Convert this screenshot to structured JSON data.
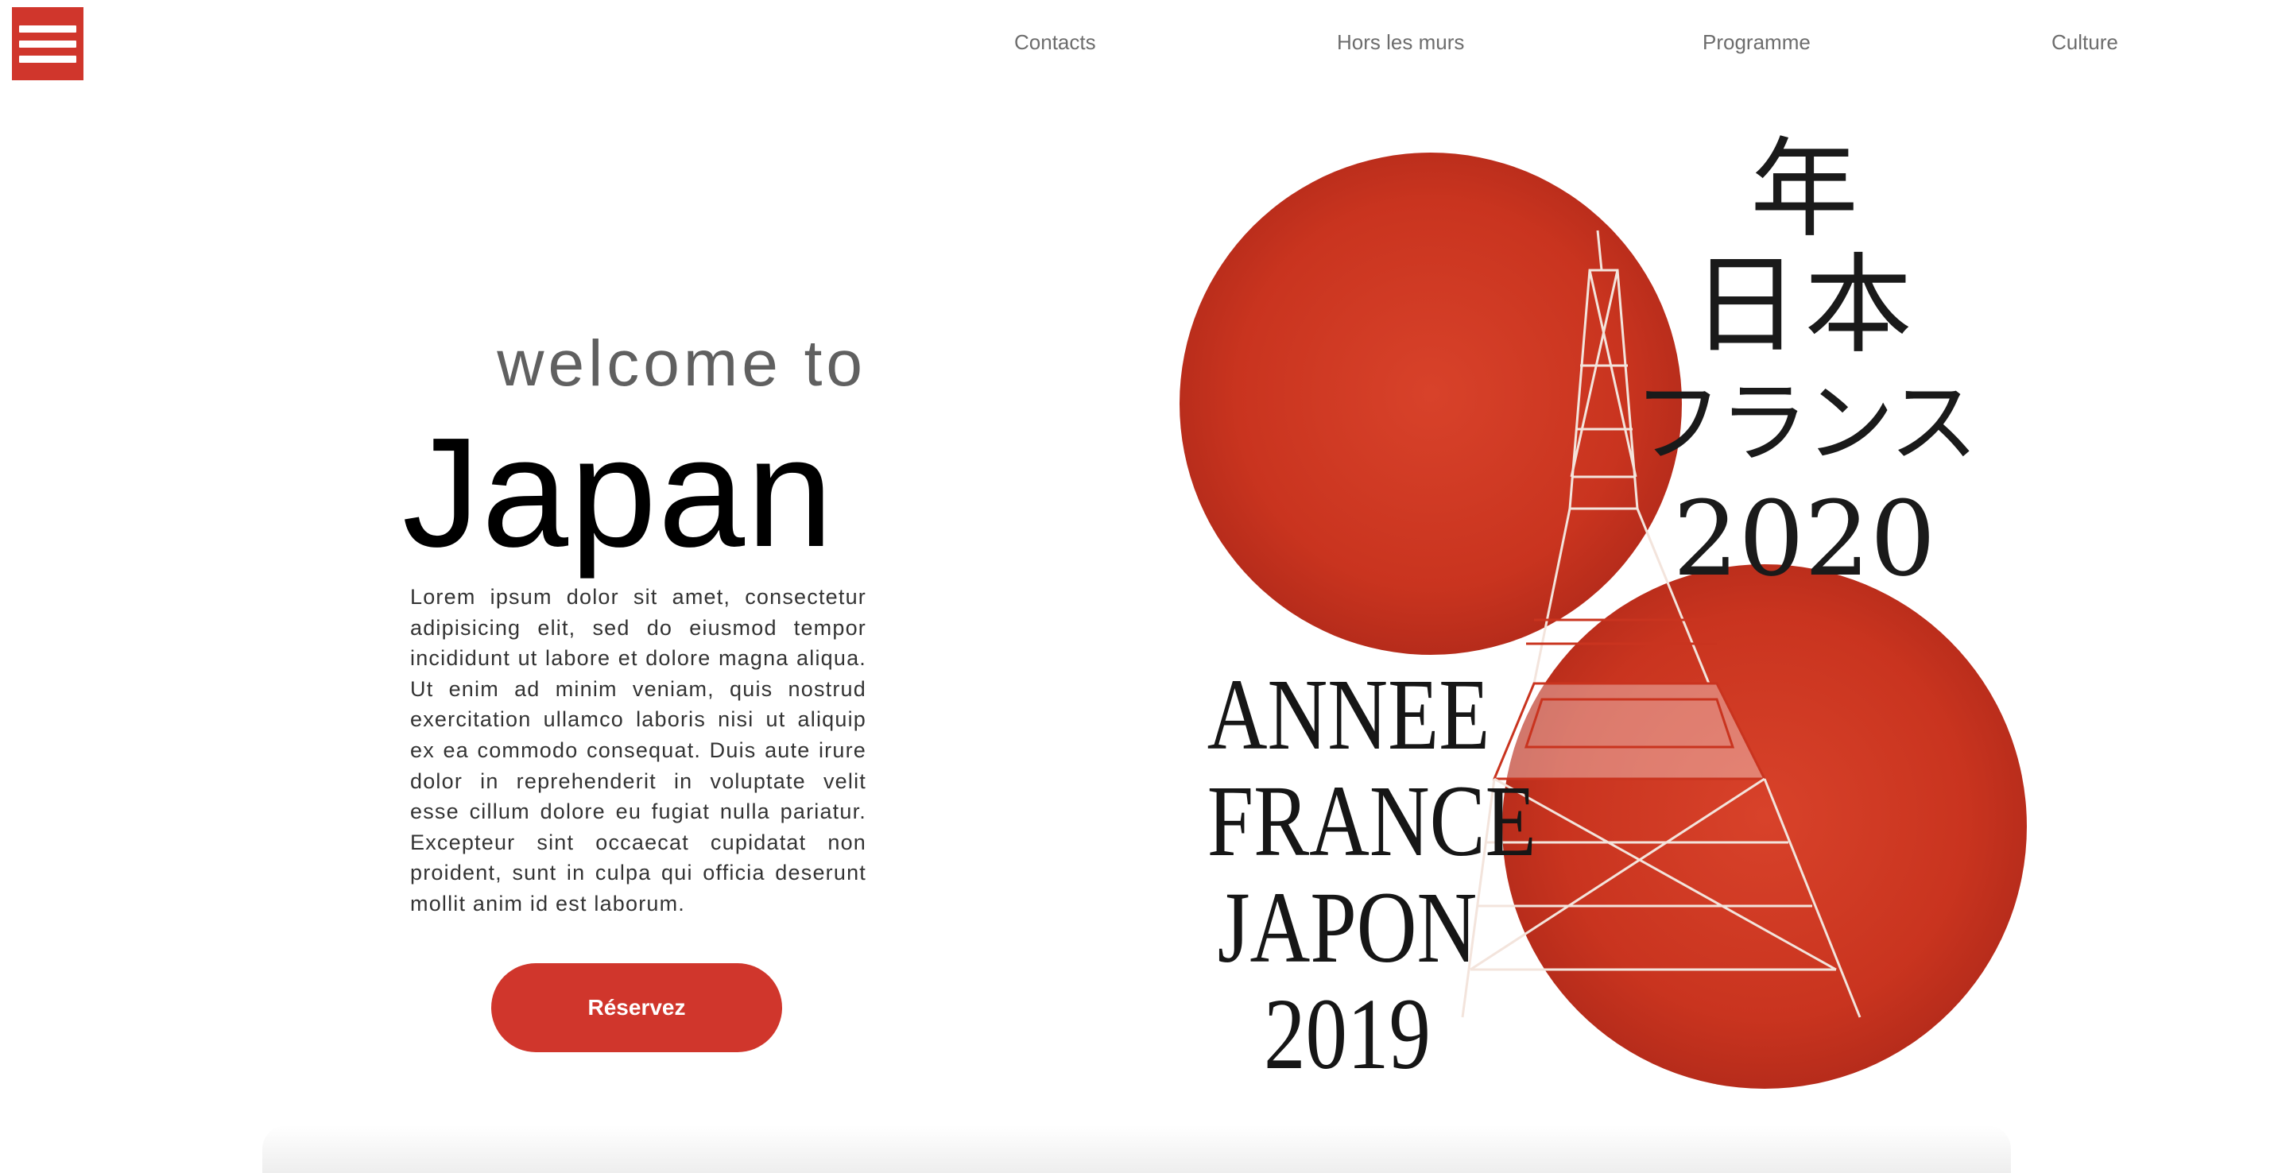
{
  "menu": {
    "icon": "hamburger-menu-icon"
  },
  "nav": {
    "items": [
      {
        "label": "Contacts"
      },
      {
        "label": "Hors les murs"
      },
      {
        "label": "Programme"
      },
      {
        "label": "Culture"
      }
    ]
  },
  "hero": {
    "welcome": "welcome to",
    "title": "Japan",
    "body": "Lorem ipsum dolor sit amet, consectetur adipisicing elit, sed do eiusmod tempor incididunt ut labore et dolore magna aliqua. Ut enim ad minim veniam, quis nostrud exercitation ullamco laboris nisi ut aliquip ex ea commodo consequat. Duis aute irure dolor in reprehenderit in voluptate velit esse cillum dolore eu fugiat nulla pariatur. Excepteur sint occaecat cupidatat non proident, sunt in culpa qui officia deserunt mollit anim id est laborum.",
    "button_label": "Réservez"
  },
  "poster": {
    "jp_line1": "年",
    "jp_line2": "日本",
    "jp_line3": "フランス",
    "jp_line4": "2020",
    "fr_line1": "ANNEE",
    "fr_line2": "FRANCE",
    "fr_line3": "JAPON",
    "fr_line4": "2019"
  },
  "colors": {
    "accent": "#d0362c",
    "sun": "#c9341f",
    "nav_text": "#6d6d6d"
  }
}
